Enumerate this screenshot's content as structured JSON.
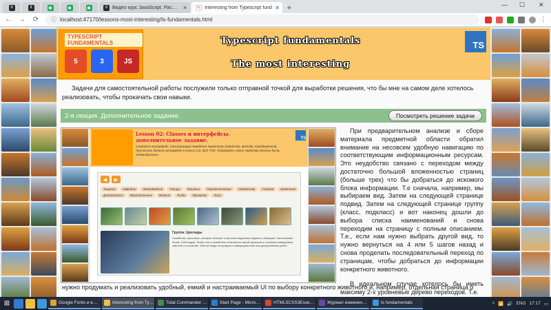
{
  "browser": {
    "tabs": [
      {
        "icon": "it",
        "label": ""
      },
      {
        "icon": "it",
        "label": ""
      },
      {
        "icon": "▣",
        "label": ""
      },
      {
        "icon": "▣",
        "label": ""
      },
      {
        "icon": "▣",
        "label": ""
      },
      {
        "icon": "it",
        "label": "Видео курс JavaScript. Расширен"
      },
      {
        "icon": "✎",
        "label": "Interesting from Typescript fund",
        "active": true
      }
    ],
    "url": "localhost:47170/lessons-most-interesting/ts-fundamentals.html",
    "win_controls": [
      "—",
      "☐",
      "✕"
    ]
  },
  "header": {
    "badge_title": "TYPESCRIPT FUNDAMENTALS",
    "tech_icons": [
      {
        "label": "5",
        "caption": "HTML"
      },
      {
        "label": "3",
        "caption": "CSS"
      },
      {
        "label": "JS",
        "caption": ""
      }
    ],
    "title": "Typescript fundamentals",
    "subtitle": "The most interesting",
    "ts_logo": "TS"
  },
  "intro": "Задачи для самостоятельной работы послужили только отправной точкой для выработки решения, что бы мне на самом деле хотелось реализовать, чтобы прокачать свои навыки.",
  "lecture": {
    "label": "2-я лекция. Дополнительное задание.",
    "button": "Посмотреть решение задачи"
  },
  "preview": {
    "lesson": "Lesson 02: Classes и интерфейсы.",
    "lesson_sub": "дополнительное задание.",
    "desc": "Создайте интерфейс, описывающий поведение животного (свойства, методы передвижения). Прописать данный интерфейс в классу Cat, Bird, Fish. Подумайте, какие свойства должны быть индивидуальны.",
    "ts": "TS",
    "arrows": [
      "◀",
      "▶"
    ],
    "categories": [
      "Хищные",
      "Амфибии",
      "Земноводные",
      "Птицы",
      "Кошачьи",
      "Парнокопытные",
      "Семейства",
      "Главная",
      "Шимпанзе",
      "Длиннолапые",
      "Вертикальные",
      "Водные",
      "Рыбы",
      "Приматы",
      "Лисы"
    ],
    "info_title": "Группа: Цихлиды",
    "info_text": "Семейство цихловых, которые обитают в пресных водоемах Африки и Америки. Насчитывает более 1300 видов. Рыбы этого семейства отличаются яркой окраской и сложным поведением, заботой о потомстве. Многие виды популярны в аквариумистике как декоративные рыбы."
  },
  "side_text": [
    "При предварительном анализе и сборе материала предметной области обратил внимание на несовсем удобную навигацию по соответствующим информационным ресурсам. Это неудобство связано с переходом между достаточно большой вложенностью страниц (больше трех) что бы добраться до искомого блока информации. Т.е сначала, например, мы выбираем вид. Затем на следующей странице подвид. Затем на следующей странице группу (класс, подкласс) и вот наконец дошли до выбора списка наименований и снова переходим на страницу с полным описанием. Т.е., если нам нужно выбрать другой вид, то нужно вернуться на 4 или 5 шагов назад и снова проделать последовательный переход по страницам, чтобы добраться до информации конкретного животного.",
    "В идеальном случае хотелось бы иметь максиму 2-х уровневые дерево переходов. Т.е."
  ],
  "bottom_text": "нужно продумать и реализовать удобный, емкий и настраиваемый UI по выбору конкретного животного и, например, отдельная страница о",
  "taskbar": {
    "tasks": [
      {
        "label": "Google Fonts и еще 6..."
      },
      {
        "label": "Interesting from Types...",
        "active": true
      },
      {
        "label": "Total Commander 7.5..."
      },
      {
        "label": "Start Page - Microsoft..."
      },
      {
        "label": "HTML5CSS3Essential..."
      },
      {
        "label": "Журнал изменения..."
      },
      {
        "label": "ts fundamentals"
      }
    ],
    "lang": "ENG",
    "time": "17:17"
  },
  "colors": {
    "header_bg": "#fbc76a",
    "badge_bg": "#ff9d00",
    "lecture_bar": "#8cc08c",
    "ts_blue": "#2f74c0"
  }
}
